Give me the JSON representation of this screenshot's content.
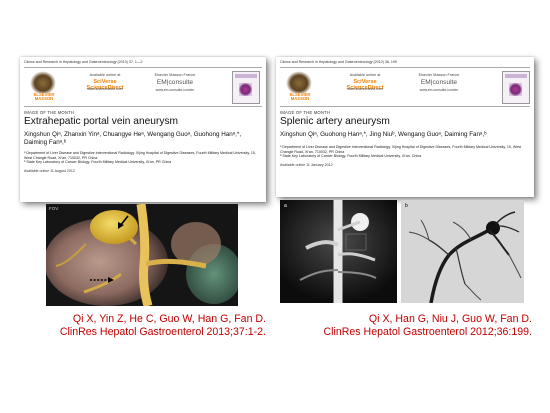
{
  "left": {
    "journal_line": "Clinics and Research in Hepatology and Gastroenterology (2013) 37, 1—2",
    "publisher_logo_text": "ELSEVIER\nMASSON",
    "available_online": "Available online at",
    "scidirect": "SciVerse ScienceDirect",
    "scidirect_url": "www.sciencedirect.com",
    "em_publisher": "Elsevier Masson France",
    "em_logo": "EM|consulte",
    "em_url": "www.em-consulte.com/en",
    "section": "IMAGE OF THE MONTH",
    "title": "Extrahepatic portal vein aneurysm",
    "authors": "Xingshun Qiᵃ, Zhanxin Yinᵃ, Chuangye Heᵃ, Wengang Guoᵃ, Guohong Hanᵃ,*, Daiming Fanᵃ,ᵇ",
    "affiliation_a": "ᵃ Department of Liver Disease and Digestive Interventional Radiology, Xijing Hospital of Digestive Diseases, Fourth Military Medical University, 15, West Changle Road, Xi'an, 710032, PR China",
    "affiliation_b": "ᵇ State Key Laboratory of Cancer Biology, Fourth Military Medical University, Xi'an, PR China",
    "available_date": "Available online 11 August 2012",
    "image_corner_label": "FOV",
    "citation_line1": "Qi X,  Yin Z, He C, Guo W, Han G, Fan D.",
    "citation_line2": "ClinRes Hepatol Gastroenterol 2013;37:1-2."
  },
  "right": {
    "journal_line": "Clinics and Research in Hepatology and Gastroenterology (2012) 36, 199",
    "publisher_logo_text": "ELSEVIER\nMASSON",
    "available_online": "Available online at",
    "scidirect": "SciVerse ScienceDirect",
    "scidirect_url": "www.sciencedirect.com",
    "em_publisher": "Elsevier Masson France",
    "em_logo": "EM|consulte",
    "em_url": "www.em-consulte.com/en",
    "section": "IMAGE OF THE MONTH",
    "title": "Splenic artery aneurysm",
    "authors": "Xingshun Qiᵃ, Guohong Hanᵃ,*, Jing Niuᵇ, Wengang Guoᵃ, Daiming Fanᵃ,ᵇ",
    "affiliation_a": "ᵃ Department of Liver Disease and Digestive Interventional Radiology, Xijing Hospital of Digestive Diseases, Fourth Military Medical University, 15, West Changle Road, Xi'an, 710032, PR China",
    "affiliation_b": "ᵇ State Key Laboratory of Cancer Biology, Fourth Military Medical University, Xi'an, China",
    "available_date": "Available online 11 January 2012",
    "panel_a": "a",
    "panel_b": "b",
    "citation_line1": "Qi X, Han G, Niu J, Guo W, Fan D.",
    "citation_line2": "ClinRes Hepatol Gastroenterol 2012;36:199."
  },
  "colors": {
    "citation": "#c00000",
    "elsevier_orange": "#f07f00"
  }
}
